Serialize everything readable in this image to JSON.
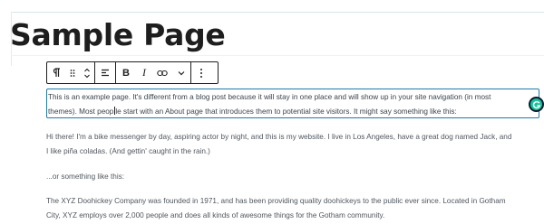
{
  "page": {
    "title": "Sample Page"
  },
  "toolbar": {
    "paragraph_icon": "pilcrow-icon",
    "drag_icon": "drag-handle-icon",
    "move_icon": "move-up-down-icon",
    "align_icon": "align-left-icon",
    "bold_label": "B",
    "italic_label": "I",
    "link_icon": "link-icon",
    "more_rich_text_icon": "chevron-down-icon",
    "options_icon": "more-vertical-icon"
  },
  "content": {
    "paragraph1_line1": "This is an example page. It's different from a blog post because it will stay in one place and will show up in your site navigation (in most",
    "paragraph1_line2_before": "themes). Most peop",
    "paragraph1_line2_after": "le start with an About page that introduces them to potential site visitors. It might say something like this:",
    "paragraph2_line1": "Hi there! I'm a bike messenger by day, aspiring actor by night, and this is my website. I live in Los Angeles, have a great dog named Jack, and",
    "paragraph2_line2": "I like piña coladas. (And gettin' caught in the rain.)",
    "paragraph3": "...or something like this:",
    "paragraph4_line1": "The XYZ Doohickey Company was founded in 1971, and has been providing quality doohickeys to the public ever since. Located in Gotham",
    "paragraph4_line2": "City, XYZ employs over 2,000 people and does all kinds of awesome things for the Gotham community."
  },
  "colors": {
    "selection_border": "#1f7aa8",
    "grammarly_green": "#15c39a",
    "text": "#50575e"
  }
}
